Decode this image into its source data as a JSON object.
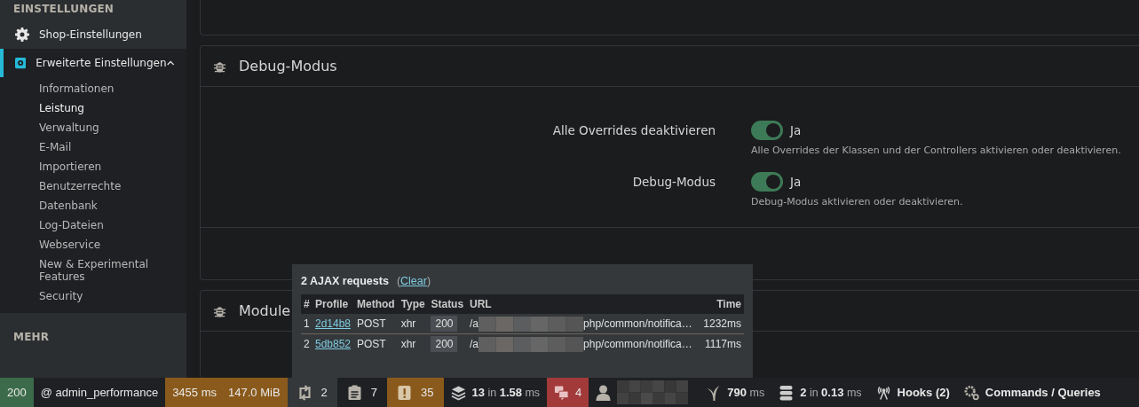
{
  "sidebar": {
    "section": "EINSTELLUNGEN",
    "items": [
      {
        "label": "Shop-Einstellungen",
        "selected": false,
        "expanded": false
      },
      {
        "label": "Erweiterte Einstellungen",
        "selected": true,
        "expanded": true,
        "children": [
          {
            "label": "Informationen",
            "selected": false
          },
          {
            "label": "Leistung",
            "selected": true
          },
          {
            "label": "Verwaltung",
            "selected": false
          },
          {
            "label": "E-Mail",
            "selected": false
          },
          {
            "label": "Importieren",
            "selected": false
          },
          {
            "label": "Benutzerrechte",
            "selected": false
          },
          {
            "label": "Datenbank",
            "selected": false
          },
          {
            "label": "Log-Dateien",
            "selected": false
          },
          {
            "label": "Webservice",
            "selected": false
          },
          {
            "label": "New & Experimental Features",
            "selected": false
          },
          {
            "label": "Security",
            "selected": false
          }
        ]
      }
    ],
    "next_section": "MEHR"
  },
  "debug_panel": {
    "title": "Debug-Modus",
    "settings": [
      {
        "label": "Alle Overrides deaktivieren",
        "on": true,
        "state_label": "Ja",
        "help": "Alle Overrides der Klassen und der Controllers aktivieren oder deaktivieren."
      },
      {
        "label": "Debug-Modus",
        "on": true,
        "state_label": "Ja",
        "help": "Debug-Modus aktivieren oder deaktivieren."
      }
    ]
  },
  "module_panel": {
    "title": "Module"
  },
  "ajax_popup": {
    "title": "2 AJAX requests",
    "clear_open": "(",
    "clear_link": "Clear",
    "clear_close": ")",
    "columns": [
      "#",
      "Profile",
      "Method",
      "Type",
      "Status",
      "URL",
      "Time"
    ],
    "rows": [
      {
        "index": "1",
        "profile": "2d14b8",
        "method": "POST",
        "type": "xhr",
        "status": "200",
        "url_start": "/a",
        "url_end": "php/common/notifica…",
        "time": "1232ms"
      },
      {
        "index": "2",
        "profile": "5db852",
        "method": "POST",
        "type": "xhr",
        "status": "200",
        "url_start": "/a",
        "url_end": "php/common/notifica…",
        "time": "1117ms"
      }
    ]
  },
  "toolbar": [
    {
      "kind": "text",
      "texts": [
        "200"
      ],
      "color": "#3b6b4a",
      "selected": false
    },
    {
      "kind": "text",
      "texts": [
        "@ admin_performance"
      ],
      "selected": false
    },
    {
      "kind": "text",
      "texts": [
        "3455 ms",
        "147.0 MiB"
      ],
      "color": "#8a5a1c",
      "selected": false
    },
    {
      "kind": "ajax",
      "texts": [
        "2"
      ],
      "selected": true
    },
    {
      "kind": "logs",
      "texts": [
        "7"
      ],
      "selected": false
    },
    {
      "kind": "alert",
      "texts": [
        "35"
      ],
      "color": "#8a5a1c",
      "selected": false
    },
    {
      "kind": "layers",
      "texts": [
        "**13** in **1.58** ms"
      ],
      "selected": false
    },
    {
      "kind": "translation",
      "texts": [
        "4"
      ],
      "color": "#a23a3a",
      "selected": false
    },
    {
      "kind": "user",
      "selected": false
    },
    {
      "kind": "time",
      "texts": [
        "**790** ms"
      ],
      "selected": false
    },
    {
      "kind": "database",
      "texts": [
        "**2** in **0.13** ms"
      ],
      "selected": false
    },
    {
      "kind": "hooks",
      "texts": [
        "Hooks (2)"
      ],
      "selected": false
    },
    {
      "kind": "commands",
      "texts": [
        "Commands / Queries"
      ],
      "selected": false
    }
  ]
}
